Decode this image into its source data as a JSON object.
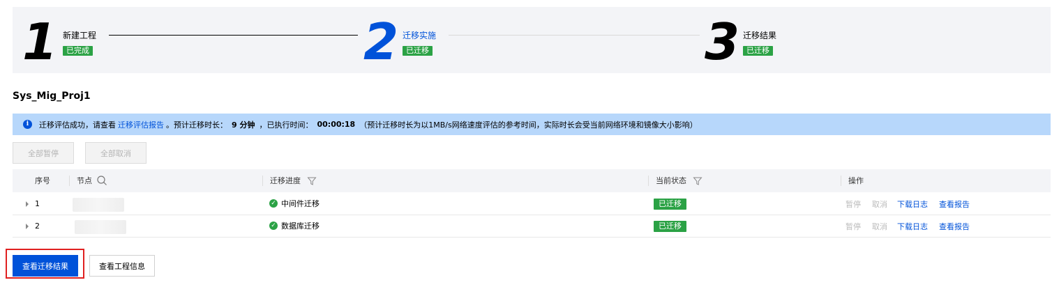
{
  "steps": [
    {
      "number": "1",
      "title": "新建工程",
      "badge": "已完成"
    },
    {
      "number": "2",
      "title": "迁移实施",
      "badge": "已迁移"
    },
    {
      "number": "3",
      "title": "迁移结果",
      "badge": "已迁移"
    }
  ],
  "colors": {
    "accent": "#0052d9",
    "success": "#2ba245",
    "alert_bg": "#b7d7fb",
    "highlight": "#e02020"
  },
  "project_name": "Sys_Mig_Proj1",
  "alert": {
    "icon": "info-icon",
    "text_before": "迁移评估成功，请查看",
    "link": "迁移评估报告",
    "text_mid": "。预计迁移时长：",
    "duration": "9 分钟",
    "text_elapsed": "，已执行时间：",
    "elapsed": "00:00:18",
    "note": "（预计迁移时长为以1MB/s网络速度评估的参考时间，实际时长会受当前网络环境和镜像大小影响）"
  },
  "bulk_actions": {
    "pause_all": "全部暂停",
    "cancel_all": "全部取消"
  },
  "table": {
    "headers": {
      "index": "序号",
      "node": "节点",
      "progress": "迁移进度",
      "status": "当前状态",
      "actions": "操作"
    },
    "rows": [
      {
        "index": "1",
        "progress": "中间件迁移",
        "status": "已迁移",
        "pause": "暂停",
        "cancel": "取消",
        "log": "下载日志",
        "report": "查看报告"
      },
      {
        "index": "2",
        "progress": "数据库迁移",
        "status": "已迁移",
        "pause": "暂停",
        "cancel": "取消",
        "log": "下载日志",
        "report": "查看报告"
      }
    ]
  },
  "footer": {
    "view_result": "查看迁移结果",
    "view_project": "查看工程信息"
  }
}
